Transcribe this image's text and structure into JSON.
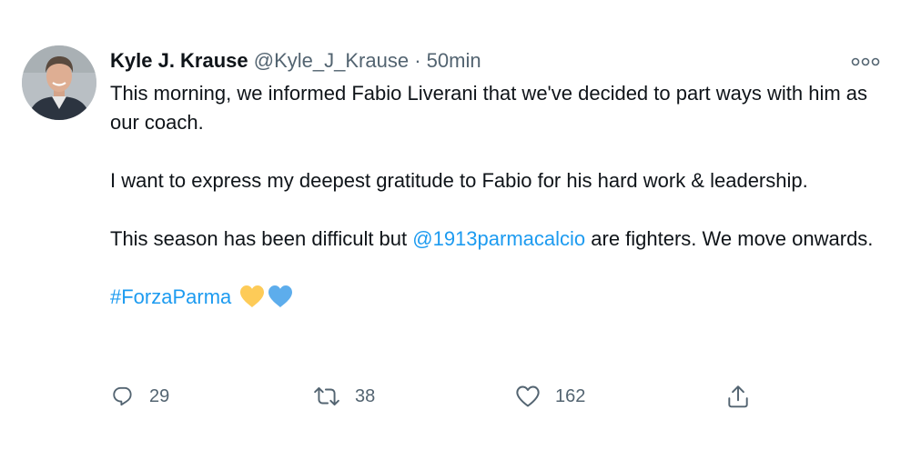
{
  "author": {
    "name": "Kyle J. Krause",
    "handle": "@Kyle_J_Krause",
    "separator": "·",
    "time": "50min"
  },
  "tweet": {
    "para1": "This morning, we informed Fabio Liverani that we've decided to part ways with him as our coach.",
    "para2": "I want to express my deepest gratitude to Fabio for his hard work & leadership.",
    "para3_before": "This season has been difficult but ",
    "para3_mention": "@1913parmacalcio",
    "para3_after": " are fighters. We move onwards.",
    "hashtag": "#ForzaParma",
    "emoji": [
      "yellow-heart",
      "blue-heart"
    ]
  },
  "actions": {
    "replies": "29",
    "retweets": "38",
    "likes": "162"
  },
  "icons": {
    "reply": "reply-icon",
    "retweet": "retweet-icon",
    "like": "like-icon",
    "share": "share-icon",
    "more": "more-options-icon"
  },
  "colors": {
    "link": "#1d9bf0",
    "secondary_text": "#536471",
    "primary_text": "#0f1419",
    "yellow_heart": "#fdcb58",
    "blue_heart": "#5dadec"
  }
}
